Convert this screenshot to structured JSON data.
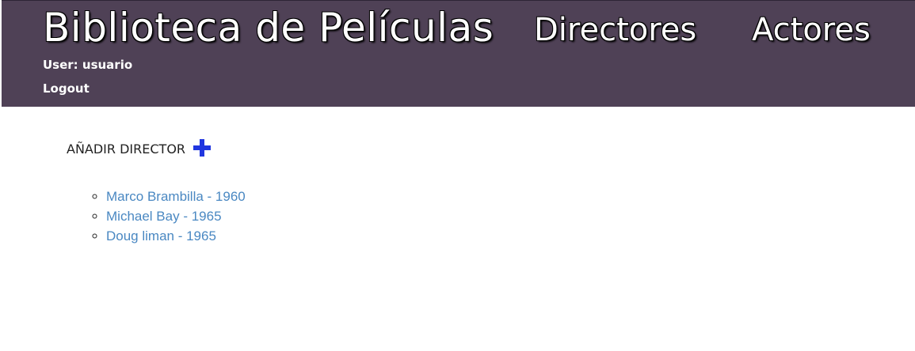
{
  "header": {
    "title": "Biblioteca de Películas",
    "nav": [
      {
        "label": "Directores"
      },
      {
        "label": "Actores"
      }
    ],
    "user_text": "User: usuario",
    "logout_label": "Logout"
  },
  "main": {
    "add_director_label": "AÑADIR DIRECTOR",
    "add_icon": "plus-icon",
    "directors": [
      {
        "label": "Marco Brambilla - 1960"
      },
      {
        "label": "Michael Bay - 1965"
      },
      {
        "label": "Doug liman - 1965"
      }
    ]
  },
  "colors": {
    "header_bg": "#4f4156",
    "link": "#4a88c2",
    "plus_icon": "#2036e0",
    "page_bg": "#ffffff"
  }
}
